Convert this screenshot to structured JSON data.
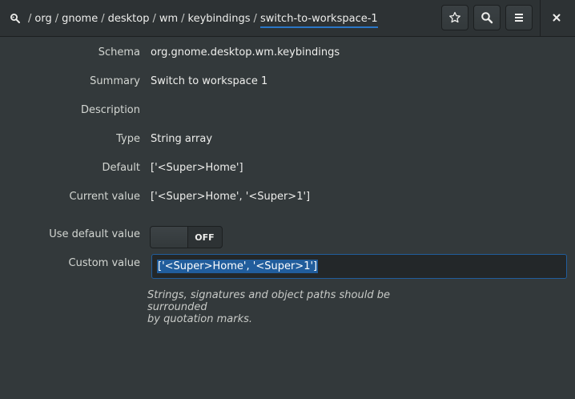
{
  "header": {
    "breadcrumb": [
      {
        "label": "org"
      },
      {
        "label": "gnome"
      },
      {
        "label": "desktop"
      },
      {
        "label": "wm"
      },
      {
        "label": "keybindings"
      },
      {
        "label": "switch-to-workspace-1",
        "current": true
      }
    ],
    "separator": "/",
    "buttons": [
      "bookmark-icon",
      "search-icon",
      "menu-icon",
      "close-icon"
    ]
  },
  "fields": {
    "schema": {
      "label": "Schema",
      "value": "org.gnome.desktop.wm.keybindings"
    },
    "summary": {
      "label": "Summary",
      "value": "Switch to workspace 1"
    },
    "description": {
      "label": "Description",
      "value": ""
    },
    "type": {
      "label": "Type",
      "value": "String array"
    },
    "default": {
      "label": "Default",
      "value": "['<Super>Home']"
    },
    "current": {
      "label": "Current value",
      "value": "['<Super>Home', '<Super>1']"
    }
  },
  "use_default": {
    "label": "Use default value",
    "state": "OFF"
  },
  "custom": {
    "label": "Custom value",
    "value": "['<Super>Home', '<Super>1']"
  },
  "hint": {
    "line1": "Strings, signatures and object paths should be surrounded",
    "line2": "by quotation marks."
  },
  "colors": {
    "accent": "#2a76c6",
    "background": "#33393b",
    "selection": "#215d9c"
  }
}
